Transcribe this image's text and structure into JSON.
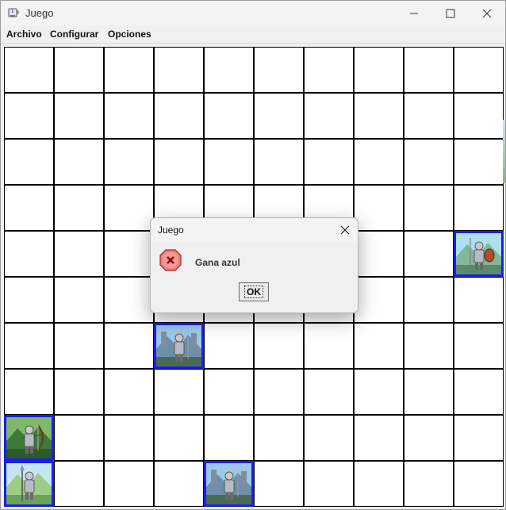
{
  "window": {
    "title": "Juego"
  },
  "menu": [
    "Archivo",
    "Configurar",
    "Opciones"
  ],
  "board": {
    "rows": 10,
    "cols": 10,
    "pieces": [
      {
        "row": 4,
        "col": 9,
        "team": "azul",
        "type": "knight-shield",
        "scene": "mountains"
      },
      {
        "row": 6,
        "col": 3,
        "team": "azul",
        "type": "knight",
        "scene": "castle"
      },
      {
        "row": 8,
        "col": 0,
        "team": "azul",
        "type": "archer",
        "scene": "forest"
      },
      {
        "row": 9,
        "col": 0,
        "team": "azul",
        "type": "lancer",
        "scene": "meadow"
      },
      {
        "row": 9,
        "col": 4,
        "team": "azul",
        "type": "knight",
        "scene": "castle"
      }
    ],
    "piece_border_color": "#1a1ee8"
  },
  "dialog": {
    "title": "Juego",
    "message": "Gana azul",
    "ok_label": "OK",
    "icon": "error-icon"
  }
}
